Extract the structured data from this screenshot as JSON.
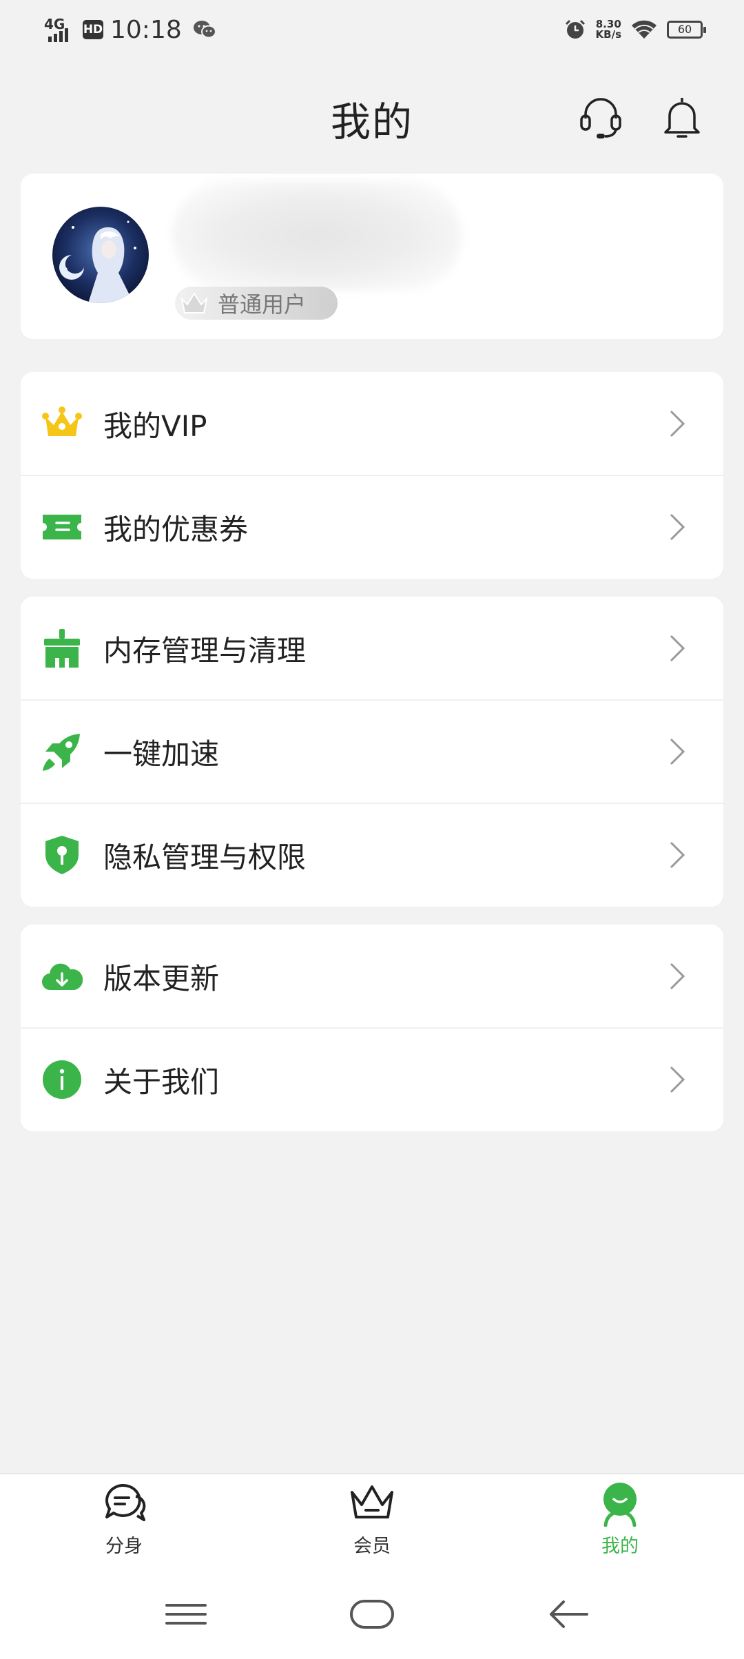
{
  "status_bar": {
    "network": "4G",
    "hd": "HD",
    "time": "10:18",
    "speed_value": "8.30",
    "speed_unit": "KB/s",
    "battery": "60",
    "icons": [
      "signal-icon",
      "wechat-icon",
      "alarm-icon",
      "wifi-icon",
      "battery-icon"
    ]
  },
  "header": {
    "title": "我的",
    "icons": [
      "headset-icon",
      "bell-icon"
    ]
  },
  "profile": {
    "badge_label": "普通用户"
  },
  "menu_groups": {
    "vip": [
      {
        "label": "我的VIP",
        "icon": "crown-icon"
      },
      {
        "label": "我的优惠券",
        "icon": "coupon-icon"
      }
    ],
    "tools": [
      {
        "label": "内存管理与清理",
        "icon": "broom-icon"
      },
      {
        "label": "一键加速",
        "icon": "rocket-icon"
      },
      {
        "label": "隐私管理与权限",
        "icon": "shield-key-icon"
      }
    ],
    "about": [
      {
        "label": "版本更新",
        "icon": "cloud-download-icon"
      },
      {
        "label": "关于我们",
        "icon": "info-icon"
      }
    ]
  },
  "bottom_nav": {
    "items": [
      {
        "label": "分身",
        "icon": "chat-icon"
      },
      {
        "label": "会员",
        "icon": "crown-outline-icon"
      },
      {
        "label": "我的",
        "icon": "user-icon",
        "active": true
      }
    ]
  },
  "colors": {
    "accent": "#3bb54a",
    "vip_gold": "#f5c518",
    "background": "#f2f2f2"
  }
}
